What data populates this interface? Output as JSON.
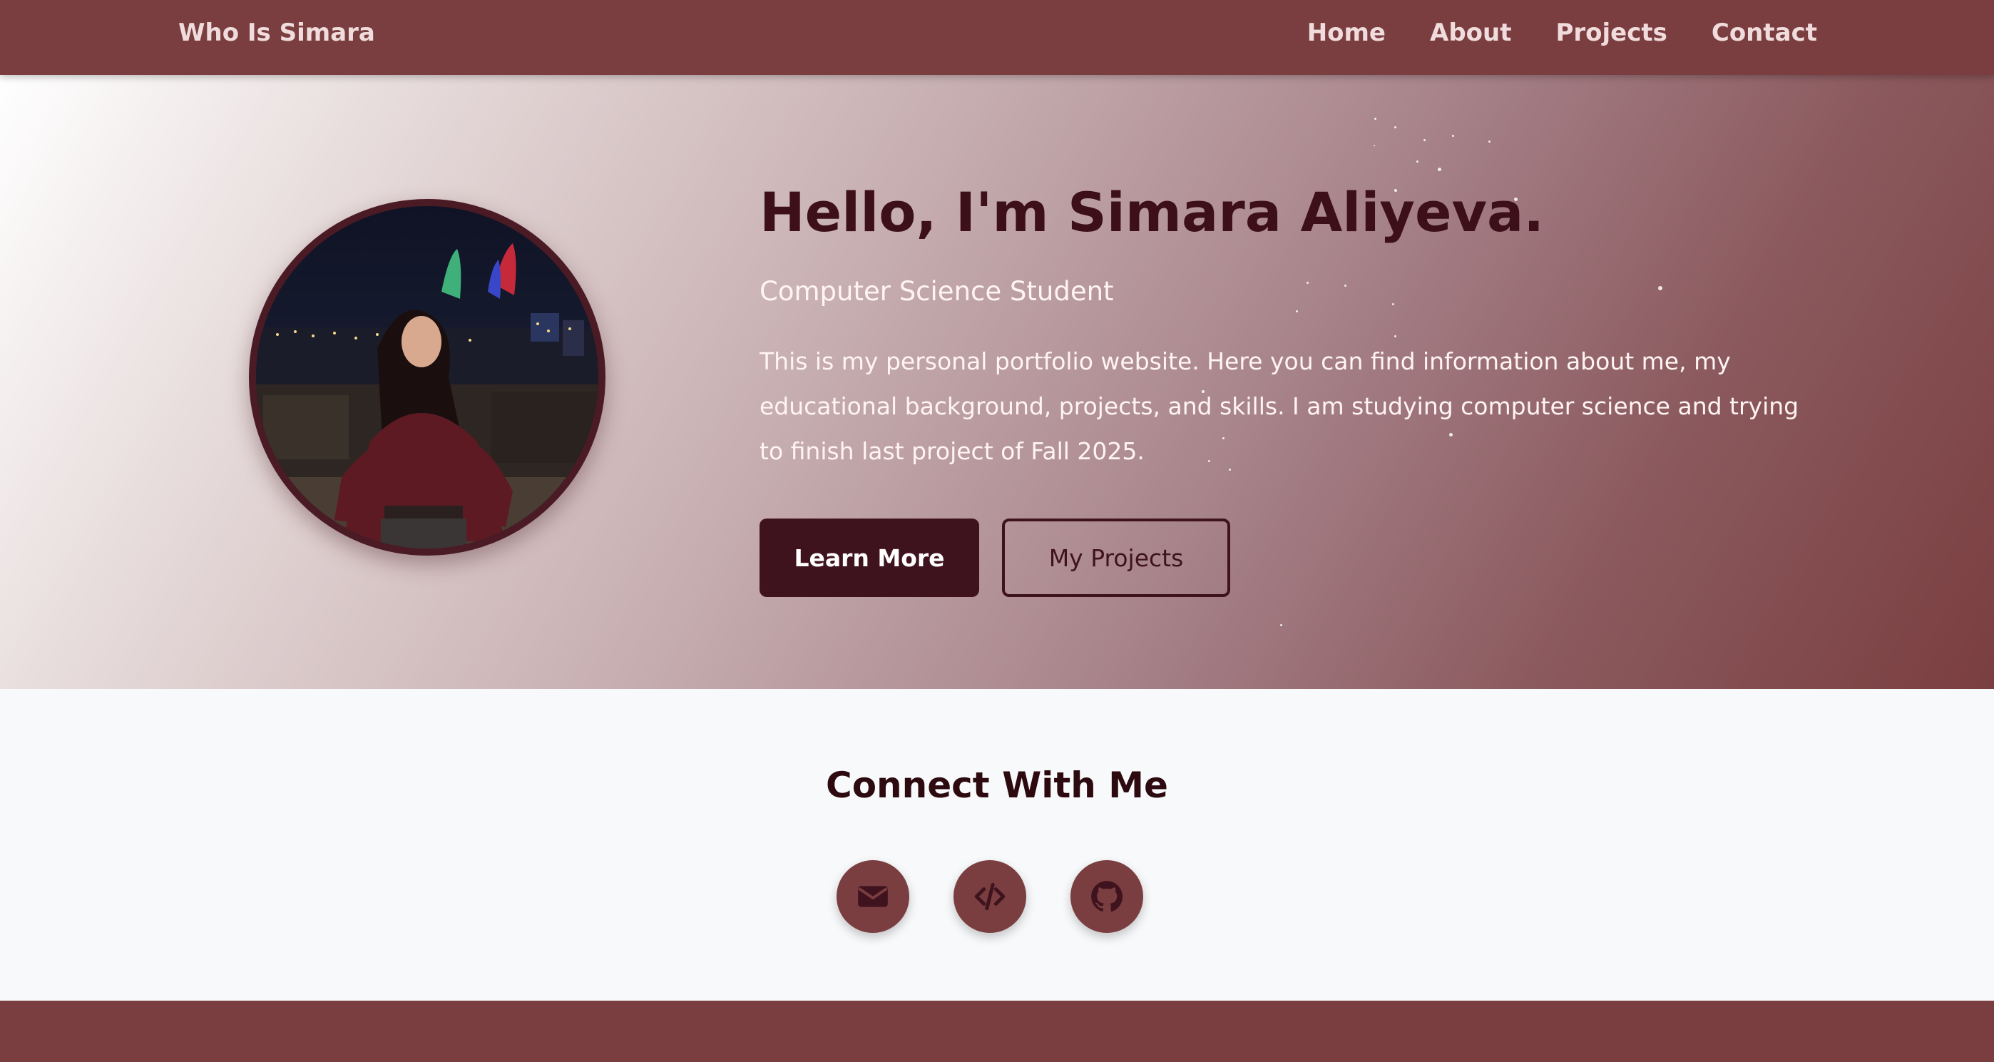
{
  "nav": {
    "brand": "Who Is Simara",
    "links": [
      "Home",
      "About",
      "Projects",
      "Contact"
    ]
  },
  "hero": {
    "title": "Hello, I'm Simara Aliyeva.",
    "subtitle": "Computer Science Student",
    "description": "This is my personal portfolio website. Here you can find information about me, my educational background, projects, and skills. I am studying computer science and trying to finish last project of Fall 2025.",
    "buttons": {
      "primary": "Learn More",
      "secondary": "My Projects"
    }
  },
  "connect": {
    "title": "Connect With Me",
    "icons": [
      "envelope-icon",
      "code-icon",
      "github-icon"
    ]
  },
  "colors": {
    "primary": "#7a3e40",
    "dark": "#3f131e",
    "background": "#f8f9fb"
  }
}
